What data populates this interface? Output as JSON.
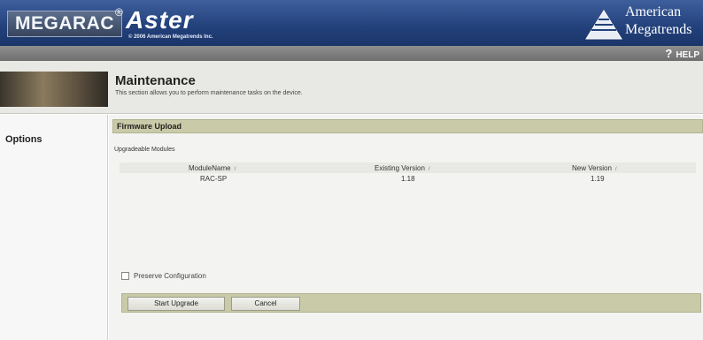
{
  "header": {
    "brand": "MEGARAC",
    "registered": "®",
    "product": "Aster",
    "copyright": "© 2006 American Megatrends Inc.",
    "vendor_line1": "American",
    "vendor_line2": "Megatrends"
  },
  "helpbar": {
    "help_icon": "?",
    "help_label": "HELP"
  },
  "banner": {
    "title": "Maintenance",
    "description": "This section allows you to perform maintenance tasks on the device."
  },
  "sidebar": {
    "options_label": "Options"
  },
  "content": {
    "section_title": "Firmware Upload",
    "modules_label": "Upgradeable Modules",
    "table": {
      "headers": [
        "ModuleName",
        "Existing Version",
        "New Version"
      ],
      "sort_glyph": "/",
      "rows": [
        [
          "RAC-SP",
          "1.18",
          "1.19"
        ]
      ]
    },
    "preserve_label": "Preserve Configuration",
    "preserve_checked": false,
    "buttons": {
      "start": "Start Upgrade",
      "cancel": "Cancel"
    }
  },
  "colors": {
    "header_blue": "#22407a",
    "section_bar": "#c9caa8",
    "helpbar_gray": "#7f7f7f"
  }
}
